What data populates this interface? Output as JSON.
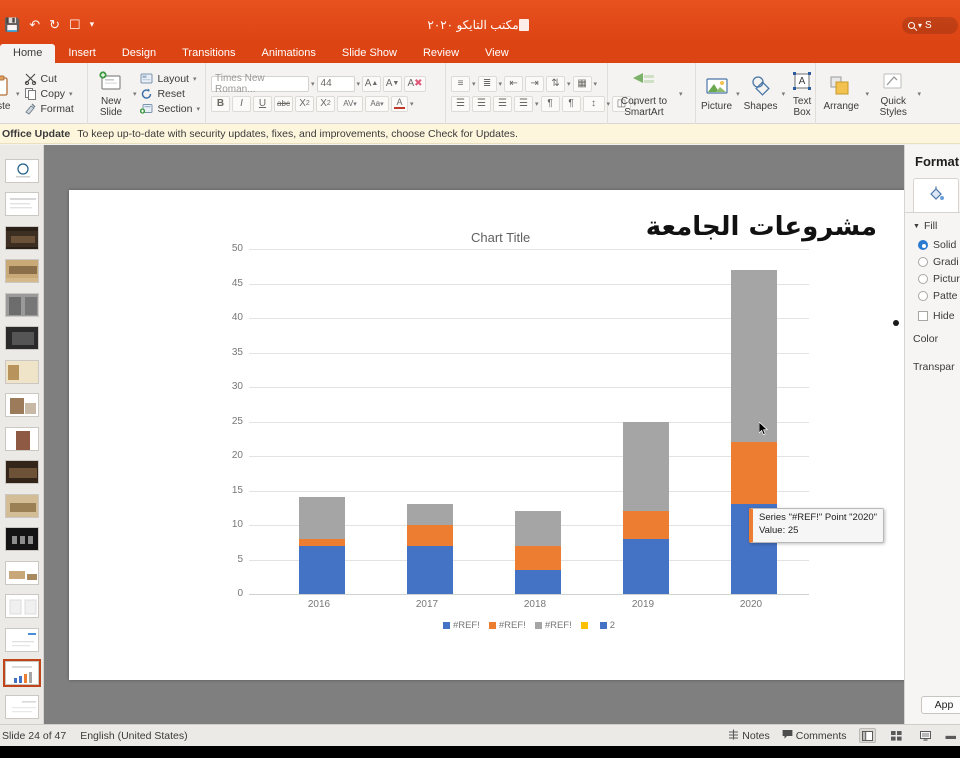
{
  "titlebar": {
    "document_title": "مكتب التايكو ٢٠٢٠",
    "search_label": "S",
    "icons": [
      "save-icon",
      "undo-icon",
      "redo-icon",
      "start-presentation-icon",
      "customize-toolbar-icon"
    ]
  },
  "ribbon": {
    "tabs": [
      {
        "label": "Home",
        "active": true
      },
      {
        "label": "Insert",
        "active": false
      },
      {
        "label": "Design",
        "active": false
      },
      {
        "label": "Transitions",
        "active": false
      },
      {
        "label": "Animations",
        "active": false
      },
      {
        "label": "Slide Show",
        "active": false
      },
      {
        "label": "Review",
        "active": false
      },
      {
        "label": "View",
        "active": false
      }
    ],
    "clipboard": {
      "paste_label": "aste",
      "cut_label": "Cut",
      "copy_label": "Copy",
      "format_label": "Format"
    },
    "slides": {
      "new_slide_label": "New\nSlide",
      "new_slide_line1": "New",
      "new_slide_line2": "Slide",
      "layout_label": "Layout",
      "reset_label": "Reset",
      "section_label": "Section"
    },
    "font": {
      "family_value": "Times New Roman...",
      "size_value": "44",
      "grow_label": "A",
      "shrink_label": "A",
      "clear_format_label": "A",
      "bold_label": "B",
      "italic_label": "I",
      "underline_label": "U",
      "strikethrough_label": "abc",
      "superscript_label": "X",
      "subscript_label": "X",
      "spacing_label": "AV",
      "case_label": "Aa",
      "font_color_label": "A"
    },
    "smartart": {
      "label_line1": "Convert to",
      "label_line2": "SmartArt"
    },
    "insert": {
      "picture_label": "Picture",
      "shapes_label": "Shapes",
      "textbox_line1": "Text",
      "textbox_line2": "Box"
    },
    "arrange": {
      "arrange_label": "Arrange",
      "quick_line1": "Quick",
      "quick_line2": "Styles"
    }
  },
  "banner": {
    "title": "Office Update",
    "message": "To keep up-to-date with security updates, fixes, and improvements, choose Check for Updates."
  },
  "slide": {
    "arabic_heading": "مشروعات الجامعة",
    "chart_title": "Chart Title",
    "tooltip": {
      "line1": "Series \"#REF!\" Point \"2020\"",
      "line2": "Value: 25"
    }
  },
  "format_pane": {
    "title": "Format",
    "tab_icon": "fill-bucket-icon",
    "section_fill": "Fill",
    "options": [
      {
        "label": "Solid",
        "type": "radio",
        "selected": true
      },
      {
        "label": "Gradi",
        "type": "radio",
        "selected": false
      },
      {
        "label": "Pictur",
        "type": "radio",
        "selected": false
      },
      {
        "label": "Patte",
        "type": "radio",
        "selected": false
      },
      {
        "label": "Hide",
        "type": "checkbox",
        "selected": false
      }
    ],
    "color_label": "Color",
    "transparency_label": "Transpar",
    "apply_label": "App"
  },
  "status": {
    "slide_counter": "Slide 24 of 47",
    "language": "English (United States)",
    "notes_label": "Notes",
    "comments_label": "Comments"
  },
  "colors": {
    "titlebar": "#dc4413",
    "series_blue": "#4472c4",
    "series_orange": "#ed7d31",
    "series_gray": "#a5a5a5",
    "series_yellow": "#ffc000",
    "banner_bg": "#fdf6dd",
    "accent_selected_thumb": "#c0441a"
  },
  "chart_data": {
    "type": "bar",
    "subtype": "stacked-column",
    "title": "Chart Title",
    "xlabel": "",
    "ylabel": "",
    "categories": [
      "2016",
      "2017",
      "2018",
      "2019",
      "2020"
    ],
    "series": [
      {
        "name": "#REF!",
        "color": "#4472c4",
        "values": [
          7,
          7,
          3.5,
          8,
          13
        ]
      },
      {
        "name": "#REF!",
        "color": "#ed7d31",
        "values": [
          1,
          3,
          3.5,
          4,
          9
        ]
      },
      {
        "name": "#REF!",
        "color": "#a5a5a5",
        "values": [
          6,
          3,
          5,
          13,
          25
        ]
      }
    ],
    "totals": [
      14,
      13,
      12,
      25,
      47
    ],
    "legend_entries": [
      {
        "label": "#REF!",
        "color": "#4472c4"
      },
      {
        "label": "#REF!",
        "color": "#ed7d31"
      },
      {
        "label": "#REF!",
        "color": "#a5a5a5"
      },
      {
        "label": "",
        "color": "#ffc000"
      },
      {
        "label": "2",
        "color": "#4472c4"
      }
    ],
    "ylim": [
      0,
      50
    ],
    "yticks": [
      0,
      5,
      10,
      15,
      20,
      25,
      30,
      35,
      40,
      45,
      50
    ],
    "grid": true,
    "legend_position": "bottom"
  }
}
